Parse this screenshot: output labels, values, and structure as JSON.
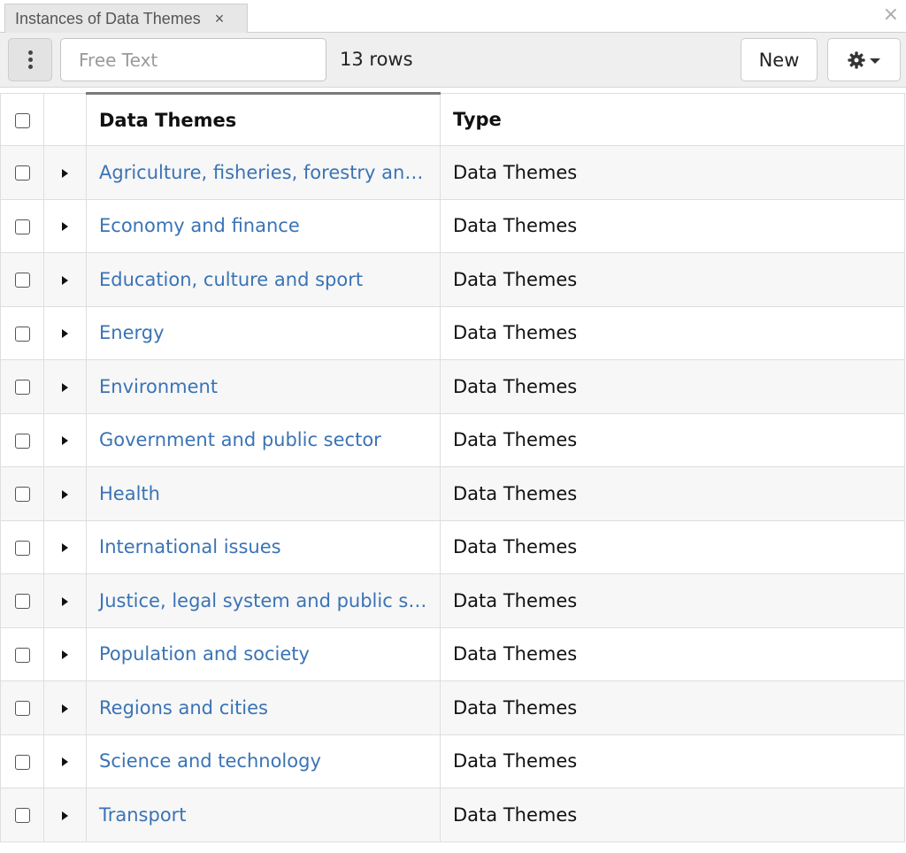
{
  "tab": {
    "title": "Instances of Data Themes",
    "close_glyph": "×"
  },
  "panel": {
    "close_glyph": "×"
  },
  "toolbar": {
    "search_placeholder": "Free Text",
    "search_value": "",
    "row_count": "13 rows",
    "new_label": "New",
    "menu_icon": "vertical-dots-icon",
    "settings_icon": "gear-icon"
  },
  "table": {
    "columns": [
      "Data Themes",
      "Type"
    ],
    "rows": [
      {
        "name": "Agriculture, fisheries, forestry and…",
        "type": "Data Themes"
      },
      {
        "name": "Economy and finance",
        "type": "Data Themes"
      },
      {
        "name": "Education, culture and sport",
        "type": "Data Themes"
      },
      {
        "name": "Energy",
        "type": "Data Themes"
      },
      {
        "name": "Environment",
        "type": "Data Themes"
      },
      {
        "name": "Government and public sector",
        "type": "Data Themes"
      },
      {
        "name": "Health",
        "type": "Data Themes"
      },
      {
        "name": "International issues",
        "type": "Data Themes"
      },
      {
        "name": "Justice, legal system and public sa…",
        "type": "Data Themes"
      },
      {
        "name": "Population and society",
        "type": "Data Themes"
      },
      {
        "name": "Regions and cities",
        "type": "Data Themes"
      },
      {
        "name": "Science and technology",
        "type": "Data Themes"
      },
      {
        "name": "Transport",
        "type": "Data Themes"
      }
    ]
  },
  "colors": {
    "link": "#3a73b5",
    "toolbar_bg": "#efefef",
    "tab_bg": "#e7e7e7"
  }
}
